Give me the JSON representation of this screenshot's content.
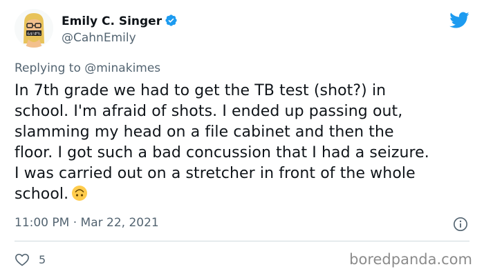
{
  "author": {
    "display_name": "Emily C. Singer",
    "handle": "@CahnEmily",
    "avatar_text": "&$!#%"
  },
  "reply": {
    "prefix": "Replying to ",
    "mention": "@minakimes"
  },
  "tweet": {
    "lines": [
      "In 7th grade we had to get the TB test (shot?) in",
      "school. I'm afraid of shots. I ended up passing out,",
      "slamming my head on a file cabinet and then the",
      "floor. I got such a bad concussion that I had a seizure.",
      "I was carried out on a stretcher in front of the whole",
      "school."
    ],
    "emoji": "upside-down-face-emoji"
  },
  "meta": {
    "time": "11:00 PM",
    "separator": " · ",
    "date": "Mar 22, 2021"
  },
  "actions": {
    "like_count": "5"
  },
  "watermark": "boredpanda.com",
  "colors": {
    "twitter_blue": "#1d9bf0",
    "text_primary": "#0f1419",
    "text_secondary": "#536471",
    "divider": "#cfd9de"
  },
  "icons": {
    "verified": "verified-badge-icon",
    "brand": "twitter-bird-icon",
    "info": "info-icon",
    "like": "heart-icon"
  }
}
